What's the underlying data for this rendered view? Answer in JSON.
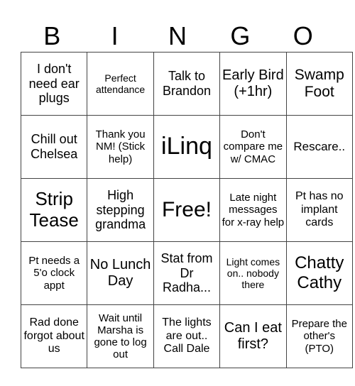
{
  "header": {
    "letters": [
      "B",
      "I",
      "N",
      "G",
      "O"
    ]
  },
  "board": {
    "rows": [
      [
        "I don't need ear plugs",
        "Perfect attendance",
        "Talk to Brandon",
        "Early Bird (+1hr)",
        "Swamp Foot"
      ],
      [
        "Chill out Chelsea",
        "Thank you NM! (Stick help)",
        "iLinq",
        "Don't compare me w/ CMAC",
        "Rescare.."
      ],
      [
        "Strip Tease",
        "High stepping grandma",
        "Free!",
        "Late night messages for x-ray help",
        "Pt has no implant cards"
      ],
      [
        "Pt needs a 5'o clock appt",
        "No Lunch Day",
        "Stat from Dr Radha...",
        "Light comes on.. nobody there",
        "Chatty Cathy"
      ],
      [
        "Rad done forgot about us",
        "Wait until Marsha is gone to log out",
        "The lights are out.. Call Dale",
        "Can I eat first?",
        "Prepare the other's (PTO)"
      ]
    ]
  }
}
